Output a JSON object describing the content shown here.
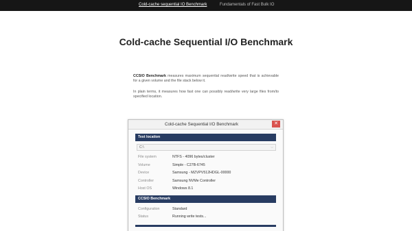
{
  "nav": {
    "items": [
      {
        "label": "Cold-cache sequential IO Benchmark",
        "active": true
      },
      {
        "label": "Fundamentals of Fast Bulk IO",
        "active": false
      }
    ]
  },
  "page": {
    "title": "Cold-cache Sequential I/O Benchmark",
    "intro_bold": "CCSIO Benchmark",
    "intro_rest": " measures maximum sequential read/write speed that is achievable for a given volume and the file stack below it.",
    "intro_para2": "In plain terms, it measures how fast one can possibly read/write very large files from/to specified location."
  },
  "window": {
    "title": "Cold-cache Sequential I/O Benchmark",
    "close_label": "✕",
    "test_location": {
      "header": "Test location",
      "select_value": "C:\\",
      "rows": [
        {
          "key": "File system",
          "value": "NTFS - 4096 bytes/cluster"
        },
        {
          "key": "Volume",
          "value": "Simple - C27B-6745"
        },
        {
          "key": "Device",
          "value": "Samsung - MZVPV512HDGL-00000"
        },
        {
          "key": "Controller",
          "value": "Samsung NVMe Controller"
        },
        {
          "key": "Host OS",
          "value": "Windows 8.1"
        }
      ]
    },
    "benchmark": {
      "header": "CCSIO Benchmark",
      "rows": [
        {
          "key": "Configuration",
          "value": "Standard"
        },
        {
          "key": "Status",
          "value": "Running write tests..."
        }
      ]
    }
  },
  "colors": {
    "nav_bg": "#161616",
    "section_bg": "#283c62",
    "close_bg": "#d9534f"
  },
  "icons": {
    "close": "close-icon",
    "dropdown": "chevron-down-icon"
  }
}
